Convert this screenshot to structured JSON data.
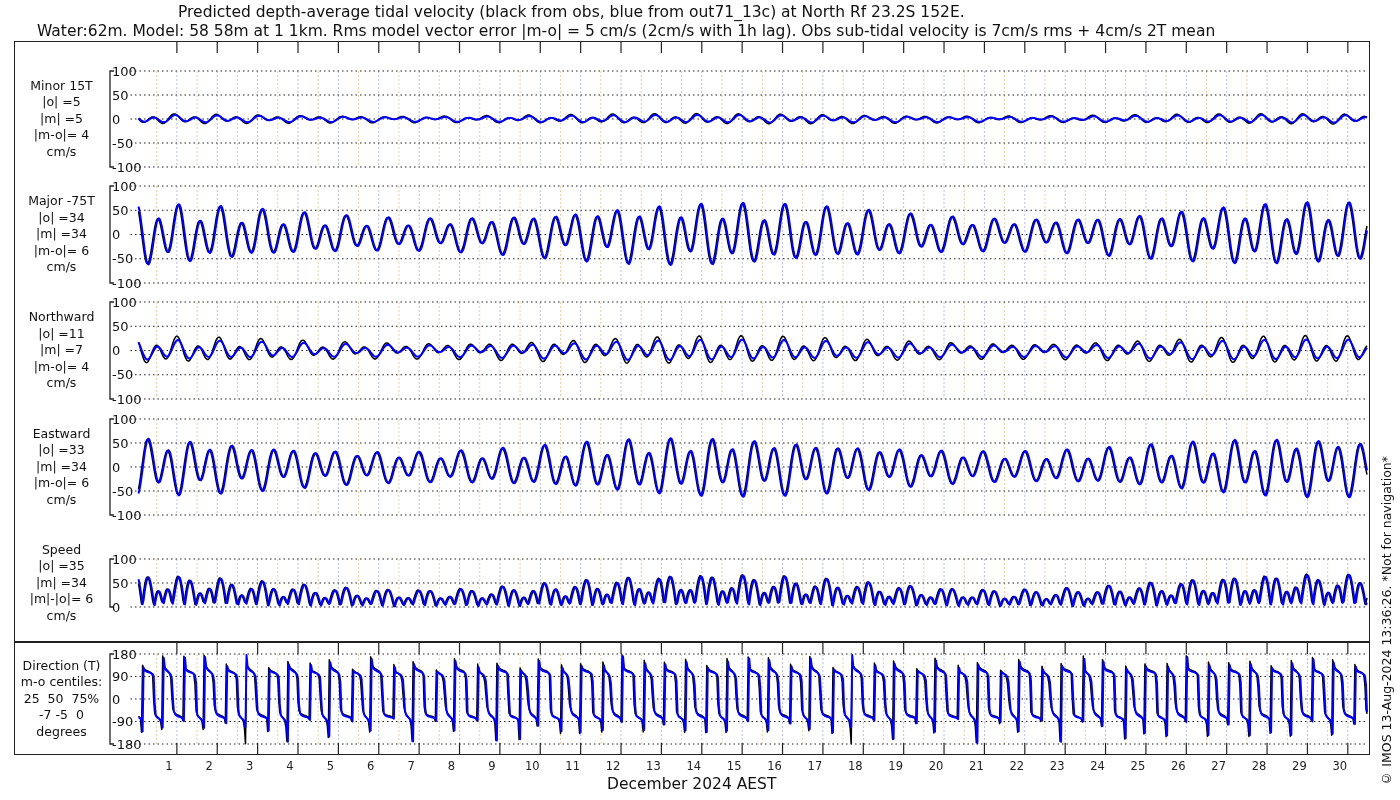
{
  "title": [
    "Predicted depth-average tidal velocity (black from obs, blue from out71_13c) at North Rf 23.2S 152E.",
    "Water:62m. Model: 58 58m at 1 1km. Rms model vector error |m-o| = 5 cm/s (2cm/s with 1h lag). Obs sub-tidal velocity is 7cm/s rms + 4cm/s 2T mean"
  ],
  "traces": [
    {
      "color": "#000000"
    },
    {
      "color": "#0000ff"
    }
  ],
  "panels": [
    {
      "kind": "minor",
      "label": [
        "Minor 15T",
        "|o| =5",
        "|m| =5",
        "|m-o|= 4",
        "cm/s"
      ],
      "yticks": [
        "100",
        "50",
        "0",
        "-50",
        "-100"
      ]
    },
    {
      "kind": "major",
      "label": [
        "Major -75T",
        "|o| =34",
        "|m| =34",
        "|m-o|= 6",
        "cm/s"
      ],
      "yticks": [
        "100",
        "50",
        "0",
        "-50",
        "-100"
      ]
    },
    {
      "kind": "northward",
      "label": [
        "Northward",
        "|o| =11",
        "|m| =7",
        "|m-o|= 4",
        "cm/s"
      ],
      "yticks": [
        "100",
        "50",
        "0",
        "-50",
        "-100"
      ]
    },
    {
      "kind": "eastward",
      "label": [
        "Eastward",
        "|o| =33",
        "|m| =34",
        "|m-o|= 6",
        "cm/s"
      ],
      "yticks": [
        "100",
        "50",
        "0",
        "-50",
        "-100"
      ]
    },
    {
      "kind": "speed",
      "label": [
        "Speed",
        "|o| =35",
        "|m| =34",
        "|m|-|o|= 6",
        "cm/s"
      ],
      "yticks": [
        "100",
        "50",
        "0"
      ]
    },
    {
      "kind": "direction",
      "label": [
        "Direction (T)",
        "m-o centiles:",
        "25  50  75%",
        "-7 -5  0",
        "degrees"
      ],
      "yticks": [
        "180",
        "90",
        "0",
        "-90",
        "-180"
      ]
    }
  ],
  "days": [
    "1",
    "2",
    "3",
    "4",
    "5",
    "6",
    "7",
    "8",
    "9",
    "10",
    "11",
    "12",
    "13",
    "14",
    "15",
    "16",
    "17",
    "18",
    "19",
    "20",
    "21",
    "22",
    "23",
    "24",
    "25",
    "26",
    "27",
    "28",
    "29",
    "30"
  ],
  "xlabel": "December 2024 AEST",
  "credit": "© IMOS 13-Aug-2024 13:36:26. *Not for navigation*"
}
